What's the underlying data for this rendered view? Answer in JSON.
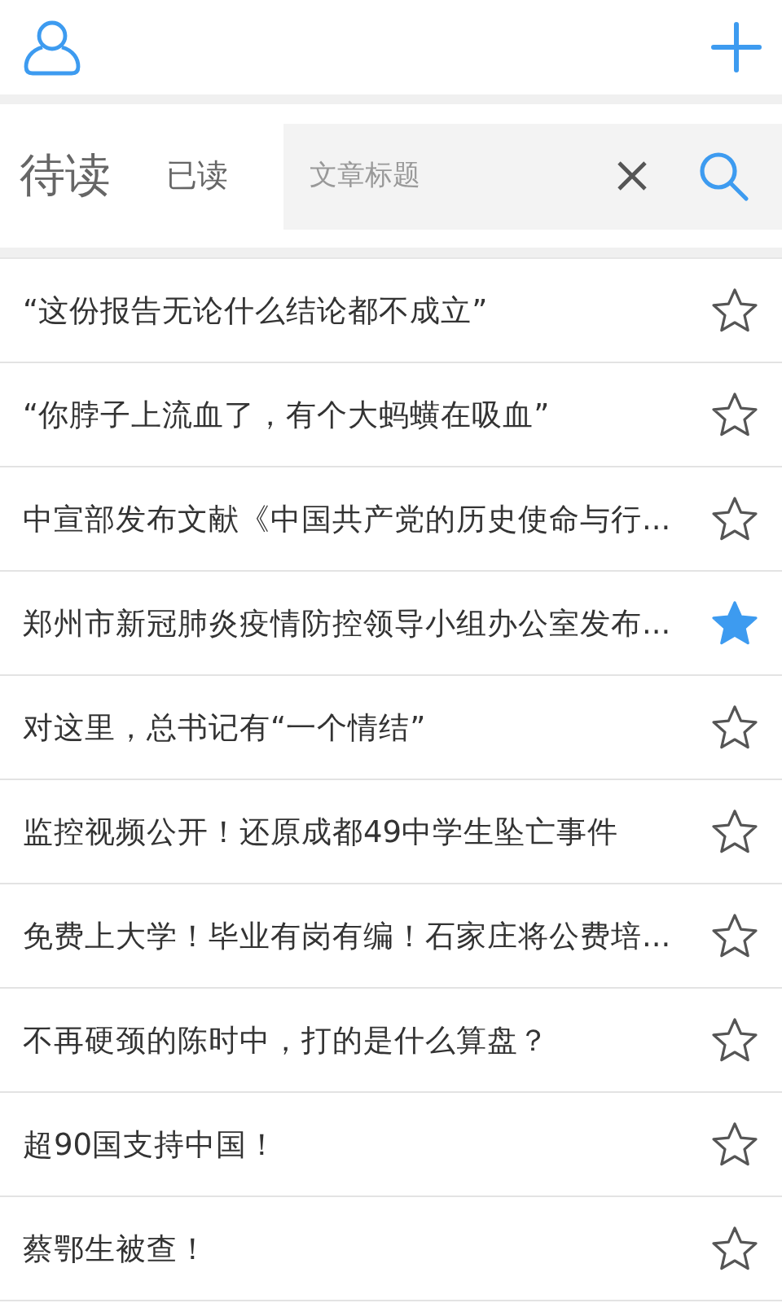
{
  "tabs": [
    {
      "label": "待读",
      "selected": true
    },
    {
      "label": "已读",
      "selected": false
    }
  ],
  "search": {
    "placeholder": "文章标题"
  },
  "articles": [
    {
      "title": "“这份报告无论什么结论都不成立”",
      "starred": false
    },
    {
      "title": "“你脖子上流血了，有个大蚂蟥在吸血”",
      "starred": false
    },
    {
      "title": "中宣部发布文献《中国共产党的历史使命与行...",
      "starred": false
    },
    {
      "title": "郑州市新冠肺炎疫情防控领导小组办公室发布...",
      "starred": true
    },
    {
      "title": "对这里，总书记有“一个情结”",
      "starred": false
    },
    {
      "title": "监控视频公开！还原成都49中学生坠亡事件",
      "starred": false
    },
    {
      "title": "免费上大学！毕业有岗有编！石家庄将公费培...",
      "starred": false
    },
    {
      "title": "不再硬颈的陈时中，打的是什么算盘？",
      "starred": false
    },
    {
      "title": "超90国支持中国！",
      "starred": false
    },
    {
      "title": "蔡鄂生被查！",
      "starred": false
    }
  ]
}
